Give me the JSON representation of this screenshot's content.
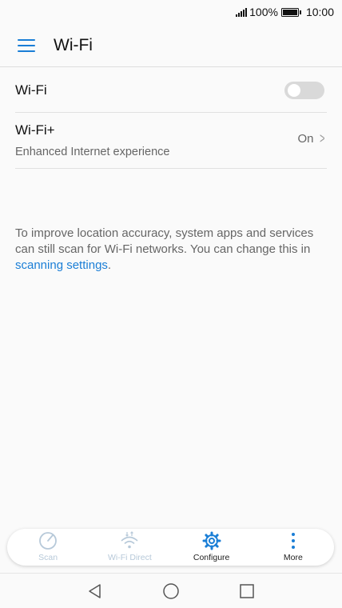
{
  "status_bar": {
    "battery": "100%",
    "time": "10:00"
  },
  "header": {
    "title": "Wi-Fi",
    "menu_icon": "hamburger-menu-icon"
  },
  "settings": {
    "wifi": {
      "label": "Wi-Fi",
      "toggle_state": "off"
    },
    "wifi_plus": {
      "label": "Wi-Fi+",
      "subtitle": "Enhanced Internet experience",
      "value": "On"
    }
  },
  "info": {
    "text": "To improve location accuracy, system apps and services can still scan for Wi-Fi networks. You can change this in",
    "link": "scanning settings",
    "end": "."
  },
  "bottom_bar": {
    "items": [
      {
        "label": "Scan",
        "icon": "scan-icon",
        "enabled": false
      },
      {
        "label": "Wi-Fi Direct",
        "icon": "wifi-direct-icon",
        "enabled": false
      },
      {
        "label": "Configure",
        "icon": "gear-icon",
        "enabled": true
      },
      {
        "label": "More",
        "icon": "more-vertical-icon",
        "enabled": true
      }
    ]
  },
  "colors": {
    "accent": "#1a7ed6",
    "disabled": "#b7c9d9",
    "background": "#fafafa"
  }
}
